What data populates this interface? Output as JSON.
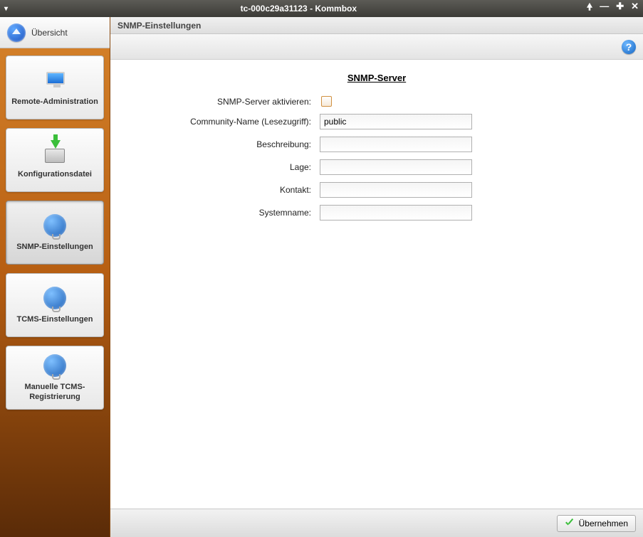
{
  "window": {
    "title": "tc-000c29a31123 - Kommbox"
  },
  "sidebar": {
    "overview_label": "Übersicht",
    "items": [
      {
        "label": "Remote-Administration"
      },
      {
        "label": "Konfigurationsdatei"
      },
      {
        "label": "SNMP-Einstellungen"
      },
      {
        "label": "TCMS-Einstellungen"
      },
      {
        "label": "Manuelle TCMS-Registrierung"
      }
    ]
  },
  "panel": {
    "header": "SNMP-Einstellungen",
    "section_title": "SNMP-Server",
    "fields": {
      "activate_label": "SNMP-Server aktivieren:",
      "activate_value": false,
      "community_label": "Community-Name (Lesezugriff):",
      "community_value": "public",
      "description_label": "Beschreibung:",
      "description_value": "",
      "location_label": "Lage:",
      "location_value": "",
      "contact_label": "Kontakt:",
      "contact_value": "",
      "sysname_label": "Systemname:",
      "sysname_value": ""
    }
  },
  "footer": {
    "apply_label": "Übernehmen"
  }
}
